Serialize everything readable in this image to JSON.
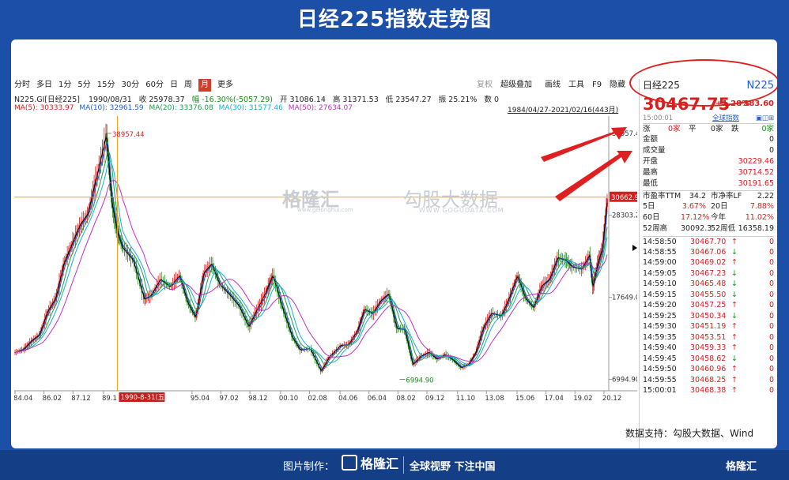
{
  "title": "日经225指数走势图",
  "toolbar": {
    "periods": [
      "分时",
      "多日",
      "1分",
      "5分",
      "15分",
      "30分",
      "60分",
      "日",
      "周",
      "月",
      "更多"
    ],
    "active_period": "月",
    "tools": [
      "复权",
      "超级叠加",
      "画线",
      "工具",
      "F9",
      "隐藏"
    ]
  },
  "info_line": {
    "code": "N225.GI[日经225]",
    "date": "1990/08/31",
    "close": "收 25978.37",
    "change": "幅 -16.30%(-5057.29)",
    "open": "开 31086.14",
    "high": "高 31371.53",
    "low": "低 23547.27",
    "amplitude": "振 25.21%",
    "volume": "数 0"
  },
  "ma_line": {
    "ma5": "MA(5): 30333.97",
    "ma10": "MA(10): 32961.59",
    "ma20": "MA(20): 33376.08",
    "ma30": "MA(30): 31577.46",
    "ma50": "MA(50): 27634.07"
  },
  "range_label": "1984/04/27-2021/02/16(443月)",
  "watermark": {
    "brand": "格隆汇",
    "brand_url": "www.gelonghui.com",
    "brand2": "勾股大数据",
    "brand2_url": "WWW.GOGUDATA.COM"
  },
  "colors": {
    "up": "#d62020",
    "down": "#1a8a1a",
    "ma5": "#000000",
    "ma10": "#1f5fd0",
    "ma20": "#19a04a",
    "ma30": "#17b0d8",
    "ma50": "#c030c0",
    "crosshair": "#f0a020"
  },
  "chart_data": {
    "type": "line",
    "title": "日经225指数走势图",
    "xlabel": "",
    "ylabel": "",
    "ylim": [
      5500,
      41000
    ],
    "y_ticks": [
      38957.44,
      28303.26,
      17649.08,
      6994.9
    ],
    "x_ticks": [
      "84.04",
      "86.02",
      "87.12",
      "89.1",
      "95.04",
      "97.02",
      "98.12",
      "00.10",
      "02.08",
      "04.06",
      "06.04",
      "08.02",
      "09.12",
      "11.10",
      "13.08",
      "15.06",
      "17.04",
      "19.02",
      "20.12"
    ],
    "x_tick_dates": [
      1984.3,
      1986.1,
      1987.9,
      1989.8,
      1995.3,
      1997.1,
      1998.9,
      2000.8,
      2002.6,
      2004.5,
      2006.3,
      2008.1,
      2009.9,
      2011.8,
      2013.6,
      2015.5,
      2017.3,
      2019.1,
      2020.9
    ],
    "x_range": [
      1984.25,
      2021.2
    ],
    "annotations": [
      {
        "label": "38957.44",
        "x": 1989.95,
        "y": 38957.44
      },
      {
        "label": "6994.90",
        "x": 2008.2,
        "y": 6994.9
      }
    ],
    "crosshair": {
      "x": 1990.66,
      "y": 30662.91,
      "x_label": "1990-8-31(五)",
      "y_label": "30662.91"
    },
    "series": [
      {
        "name": "N225.GI[日经225]",
        "x": [
          1984.3,
          1984.8,
          1985.3,
          1985.8,
          1986.3,
          1986.8,
          1987.3,
          1987.8,
          1988.3,
          1988.8,
          1989.3,
          1989.95,
          1990.3,
          1990.66,
          1991.0,
          1991.6,
          1992.3,
          1992.7,
          1993.3,
          1993.9,
          1994.5,
          1995.0,
          1995.5,
          1996.0,
          1996.5,
          1997.0,
          1997.6,
          1998.2,
          1998.8,
          1999.3,
          1999.9,
          2000.3,
          2000.9,
          2001.5,
          2002.0,
          2002.6,
          2003.3,
          2003.8,
          2004.5,
          2005.0,
          2005.6,
          2006.0,
          2006.5,
          2007.0,
          2007.5,
          2008.0,
          2008.5,
          2009.0,
          2009.5,
          2010.0,
          2010.5,
          2011.0,
          2011.5,
          2012.0,
          2012.5,
          2012.9,
          2013.4,
          2013.9,
          2014.5,
          2015.0,
          2015.5,
          2016.0,
          2016.5,
          2017.0,
          2017.5,
          2018.0,
          2018.5,
          2018.9,
          2019.5,
          2020.0,
          2020.2,
          2020.5,
          2020.8,
          2021.1
        ],
        "values": [
          10500,
          10900,
          12000,
          12800,
          15800,
          17500,
          22000,
          24500,
          27000,
          28500,
          33000,
          38915,
          29980,
          25978,
          24000,
          22500,
          17400,
          17800,
          20000,
          19000,
          20500,
          17000,
          15000,
          20800,
          22000,
          19300,
          18000,
          16500,
          13800,
          16000,
          18500,
          20500,
          16200,
          12500,
          10800,
          11000,
          8000,
          9900,
          11400,
          11500,
          13500,
          16100,
          15500,
          17200,
          18100,
          13600,
          13500,
          8900,
          10000,
          10500,
          9600,
          10200,
          9500,
          8500,
          9000,
          10400,
          13800,
          15600,
          15200,
          17600,
          20500,
          17500,
          16300,
          19100,
          20000,
          22800,
          22500,
          21600,
          21300,
          23200,
          19000,
          22000,
          24000,
          30467
        ]
      }
    ]
  },
  "panel": {
    "name": "日经225",
    "code": "N225",
    "price": "30467.75",
    "change": "+1.28%",
    "change_pts": "+383.60",
    "time": "15:00:01",
    "link": "全球指数",
    "rise": "涨",
    "rise_val": "0家",
    "flat": "平",
    "flat_val": "0家",
    "fall": "跌",
    "fall_val": "0家",
    "stats": [
      {
        "label": "金额",
        "value": "0"
      },
      {
        "label": "成交量",
        "value": "0"
      },
      {
        "label": "开盘",
        "value": "30229.46"
      },
      {
        "label": "最高",
        "value": "30714.52"
      },
      {
        "label": "最低",
        "value": "30191.65"
      }
    ],
    "ratios": [
      {
        "l1": "市盈率TTM",
        "v1": "34.2",
        "l2": "市净率LF",
        "v2": "2.22"
      },
      {
        "l1": "5日",
        "v1": "3.67%",
        "l2": "20日",
        "v2": "7.88%"
      },
      {
        "l1": "60日",
        "v1": "17.12%",
        "l2": "今年",
        "v2": "11.02%"
      },
      {
        "l1": "52周高",
        "v1": "30092.3",
        "l2": "52周低",
        "v2": "16358.19"
      }
    ],
    "ticks": [
      {
        "t": "14:58:50",
        "p": "30467.70",
        "d": "up",
        "v": "0"
      },
      {
        "t": "14:58:55",
        "p": "30467.06",
        "d": "down",
        "v": "0"
      },
      {
        "t": "14:59:00",
        "p": "30469.02",
        "d": "up",
        "v": "0"
      },
      {
        "t": "14:59:05",
        "p": "30467.23",
        "d": "down",
        "v": "0"
      },
      {
        "t": "14:59:10",
        "p": "30465.48",
        "d": "down",
        "v": "0"
      },
      {
        "t": "14:59:15",
        "p": "30455.50",
        "d": "down",
        "v": "0"
      },
      {
        "t": "14:59:20",
        "p": "30457.25",
        "d": "up",
        "v": "0"
      },
      {
        "t": "14:59:25",
        "p": "30450.34",
        "d": "down",
        "v": "0"
      },
      {
        "t": "14:59:30",
        "p": "30451.19",
        "d": "up",
        "v": "0"
      },
      {
        "t": "14:59:35",
        "p": "30453.51",
        "d": "up",
        "v": "0"
      },
      {
        "t": "14:59:40",
        "p": "30459.33",
        "d": "up",
        "v": "0"
      },
      {
        "t": "14:59:45",
        "p": "30458.62",
        "d": "down",
        "v": "0"
      },
      {
        "t": "14:59:50",
        "p": "30460.96",
        "d": "up",
        "v": "0"
      },
      {
        "t": "14:59:55",
        "p": "30468.25",
        "d": "up",
        "v": "0"
      },
      {
        "t": "15:00:01",
        "p": "30468.38",
        "d": "up",
        "v": "0"
      }
    ]
  },
  "source_text": "数据支持：勾股大数据、Wind",
  "footer": {
    "made_by": "图片制作：",
    "brand": "格隆汇",
    "slogan": "全球视野 下注中国",
    "right_brand": "格隆汇"
  }
}
